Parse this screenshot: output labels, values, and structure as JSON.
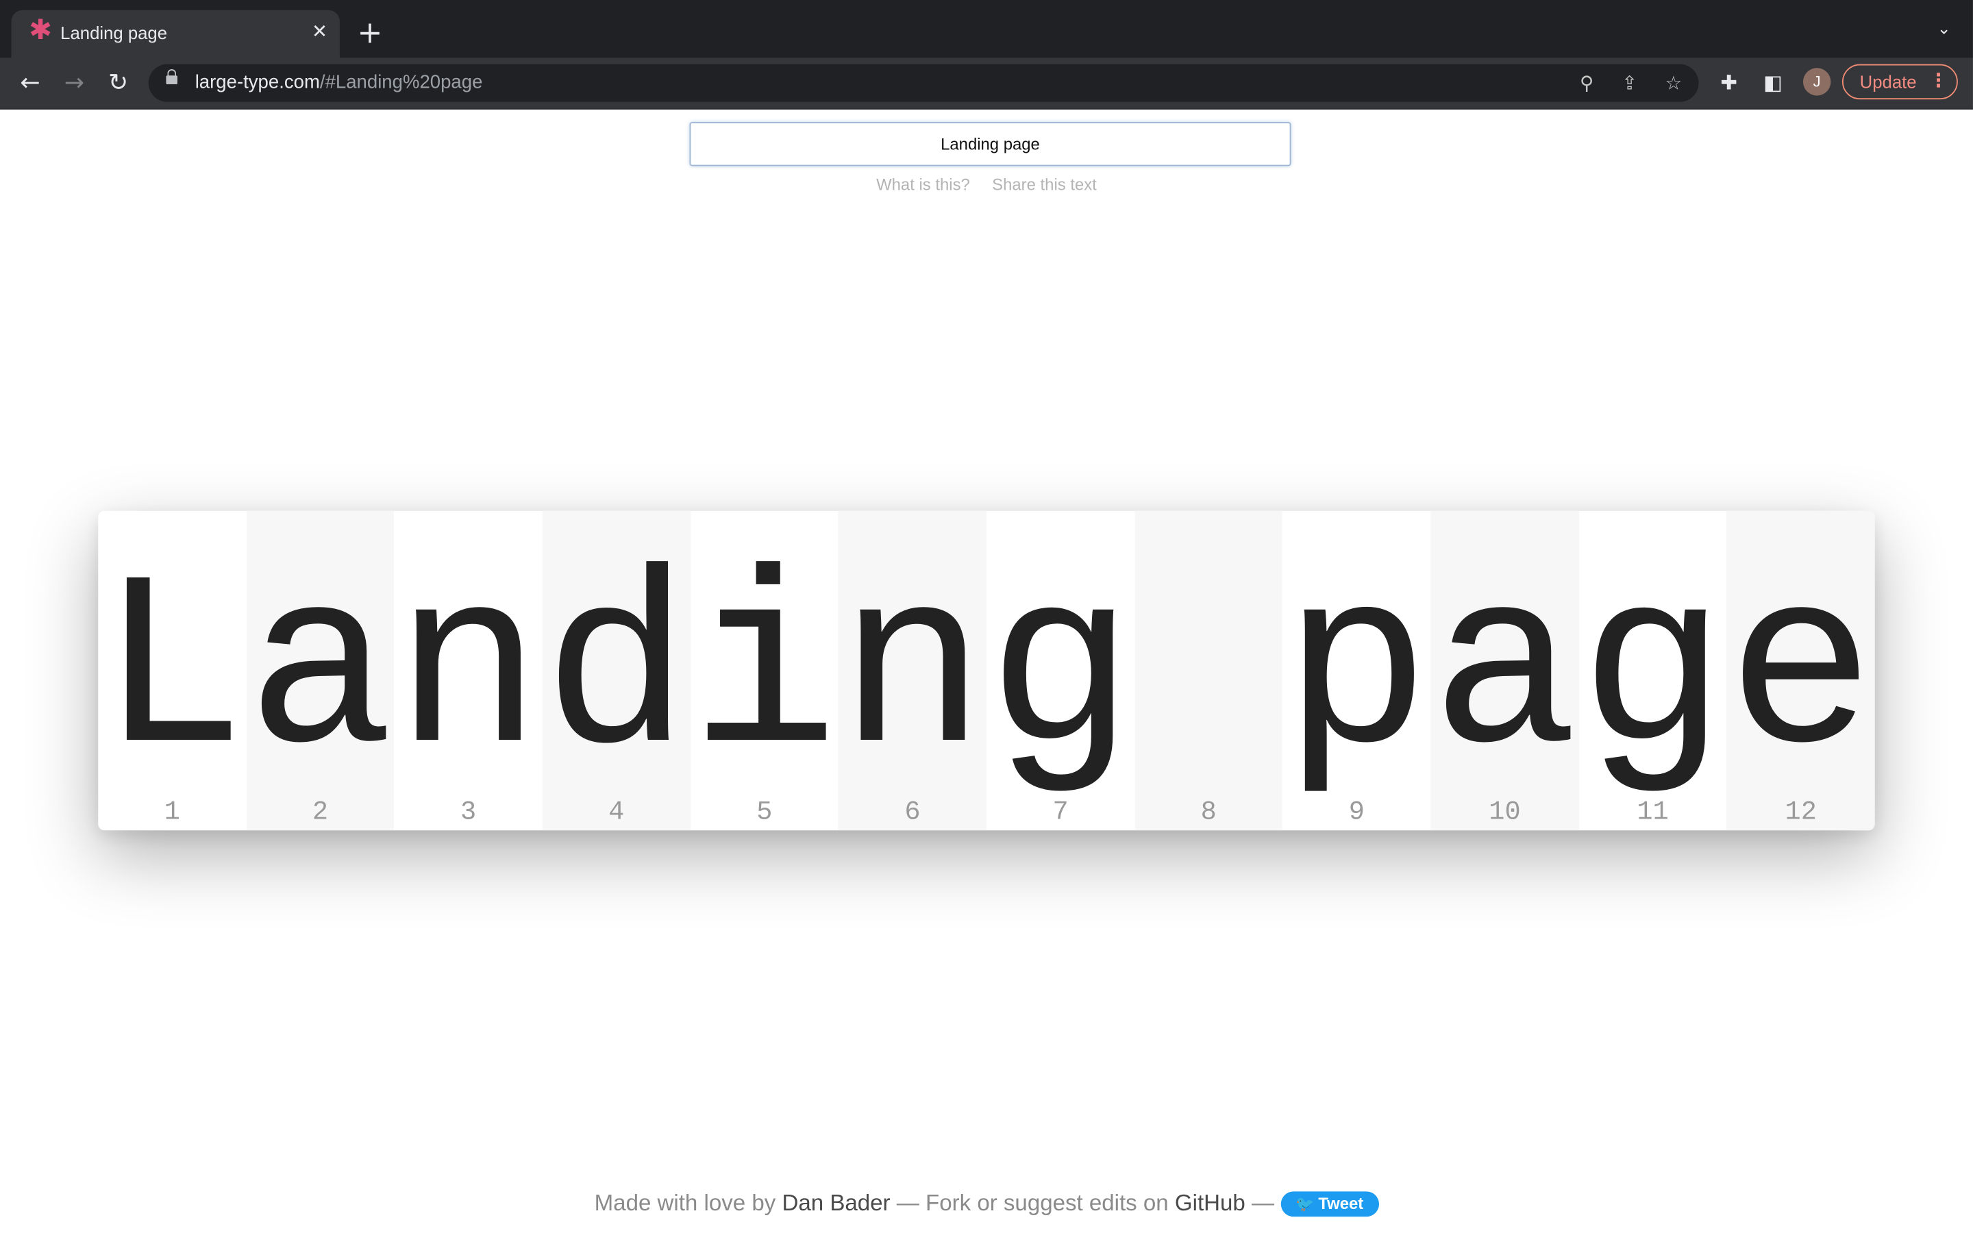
{
  "browser": {
    "tab_title": "Landing page",
    "url_host": "large-type.com",
    "url_path": "/#Landing%20page",
    "update_label": "Update",
    "avatar_initial": "J",
    "favicon_icon": "asterisk-icon",
    "tab_close_icon": "close-icon",
    "new_tab_icon": "plus-icon",
    "tab_search_icon": "chevron-down-icon",
    "accent_update_color": "#f28b82"
  },
  "page": {
    "input_value": "Landing page",
    "links": [
      "What is this?",
      "Share this text"
    ],
    "characters": [
      {
        "char": "L",
        "index": "1"
      },
      {
        "char": "a",
        "index": "2"
      },
      {
        "char": "n",
        "index": "3"
      },
      {
        "char": "d",
        "index": "4"
      },
      {
        "char": "i",
        "index": "5"
      },
      {
        "char": "n",
        "index": "6"
      },
      {
        "char": "g",
        "index": "7"
      },
      {
        "char": " ",
        "index": "8"
      },
      {
        "char": "p",
        "index": "9"
      },
      {
        "char": "a",
        "index": "10"
      },
      {
        "char": "g",
        "index": "11"
      },
      {
        "char": "e",
        "index": "12"
      }
    ],
    "alt_cell_color": "#f7f7f7"
  },
  "footer": {
    "made_with": "Made with love by",
    "author": "Dan Bader",
    "fork_text": "— Fork or suggest edits on",
    "github": "GitHub",
    "dash": "—",
    "tweet_label": "Tweet",
    "tweet_color": "#1d9bf0"
  }
}
